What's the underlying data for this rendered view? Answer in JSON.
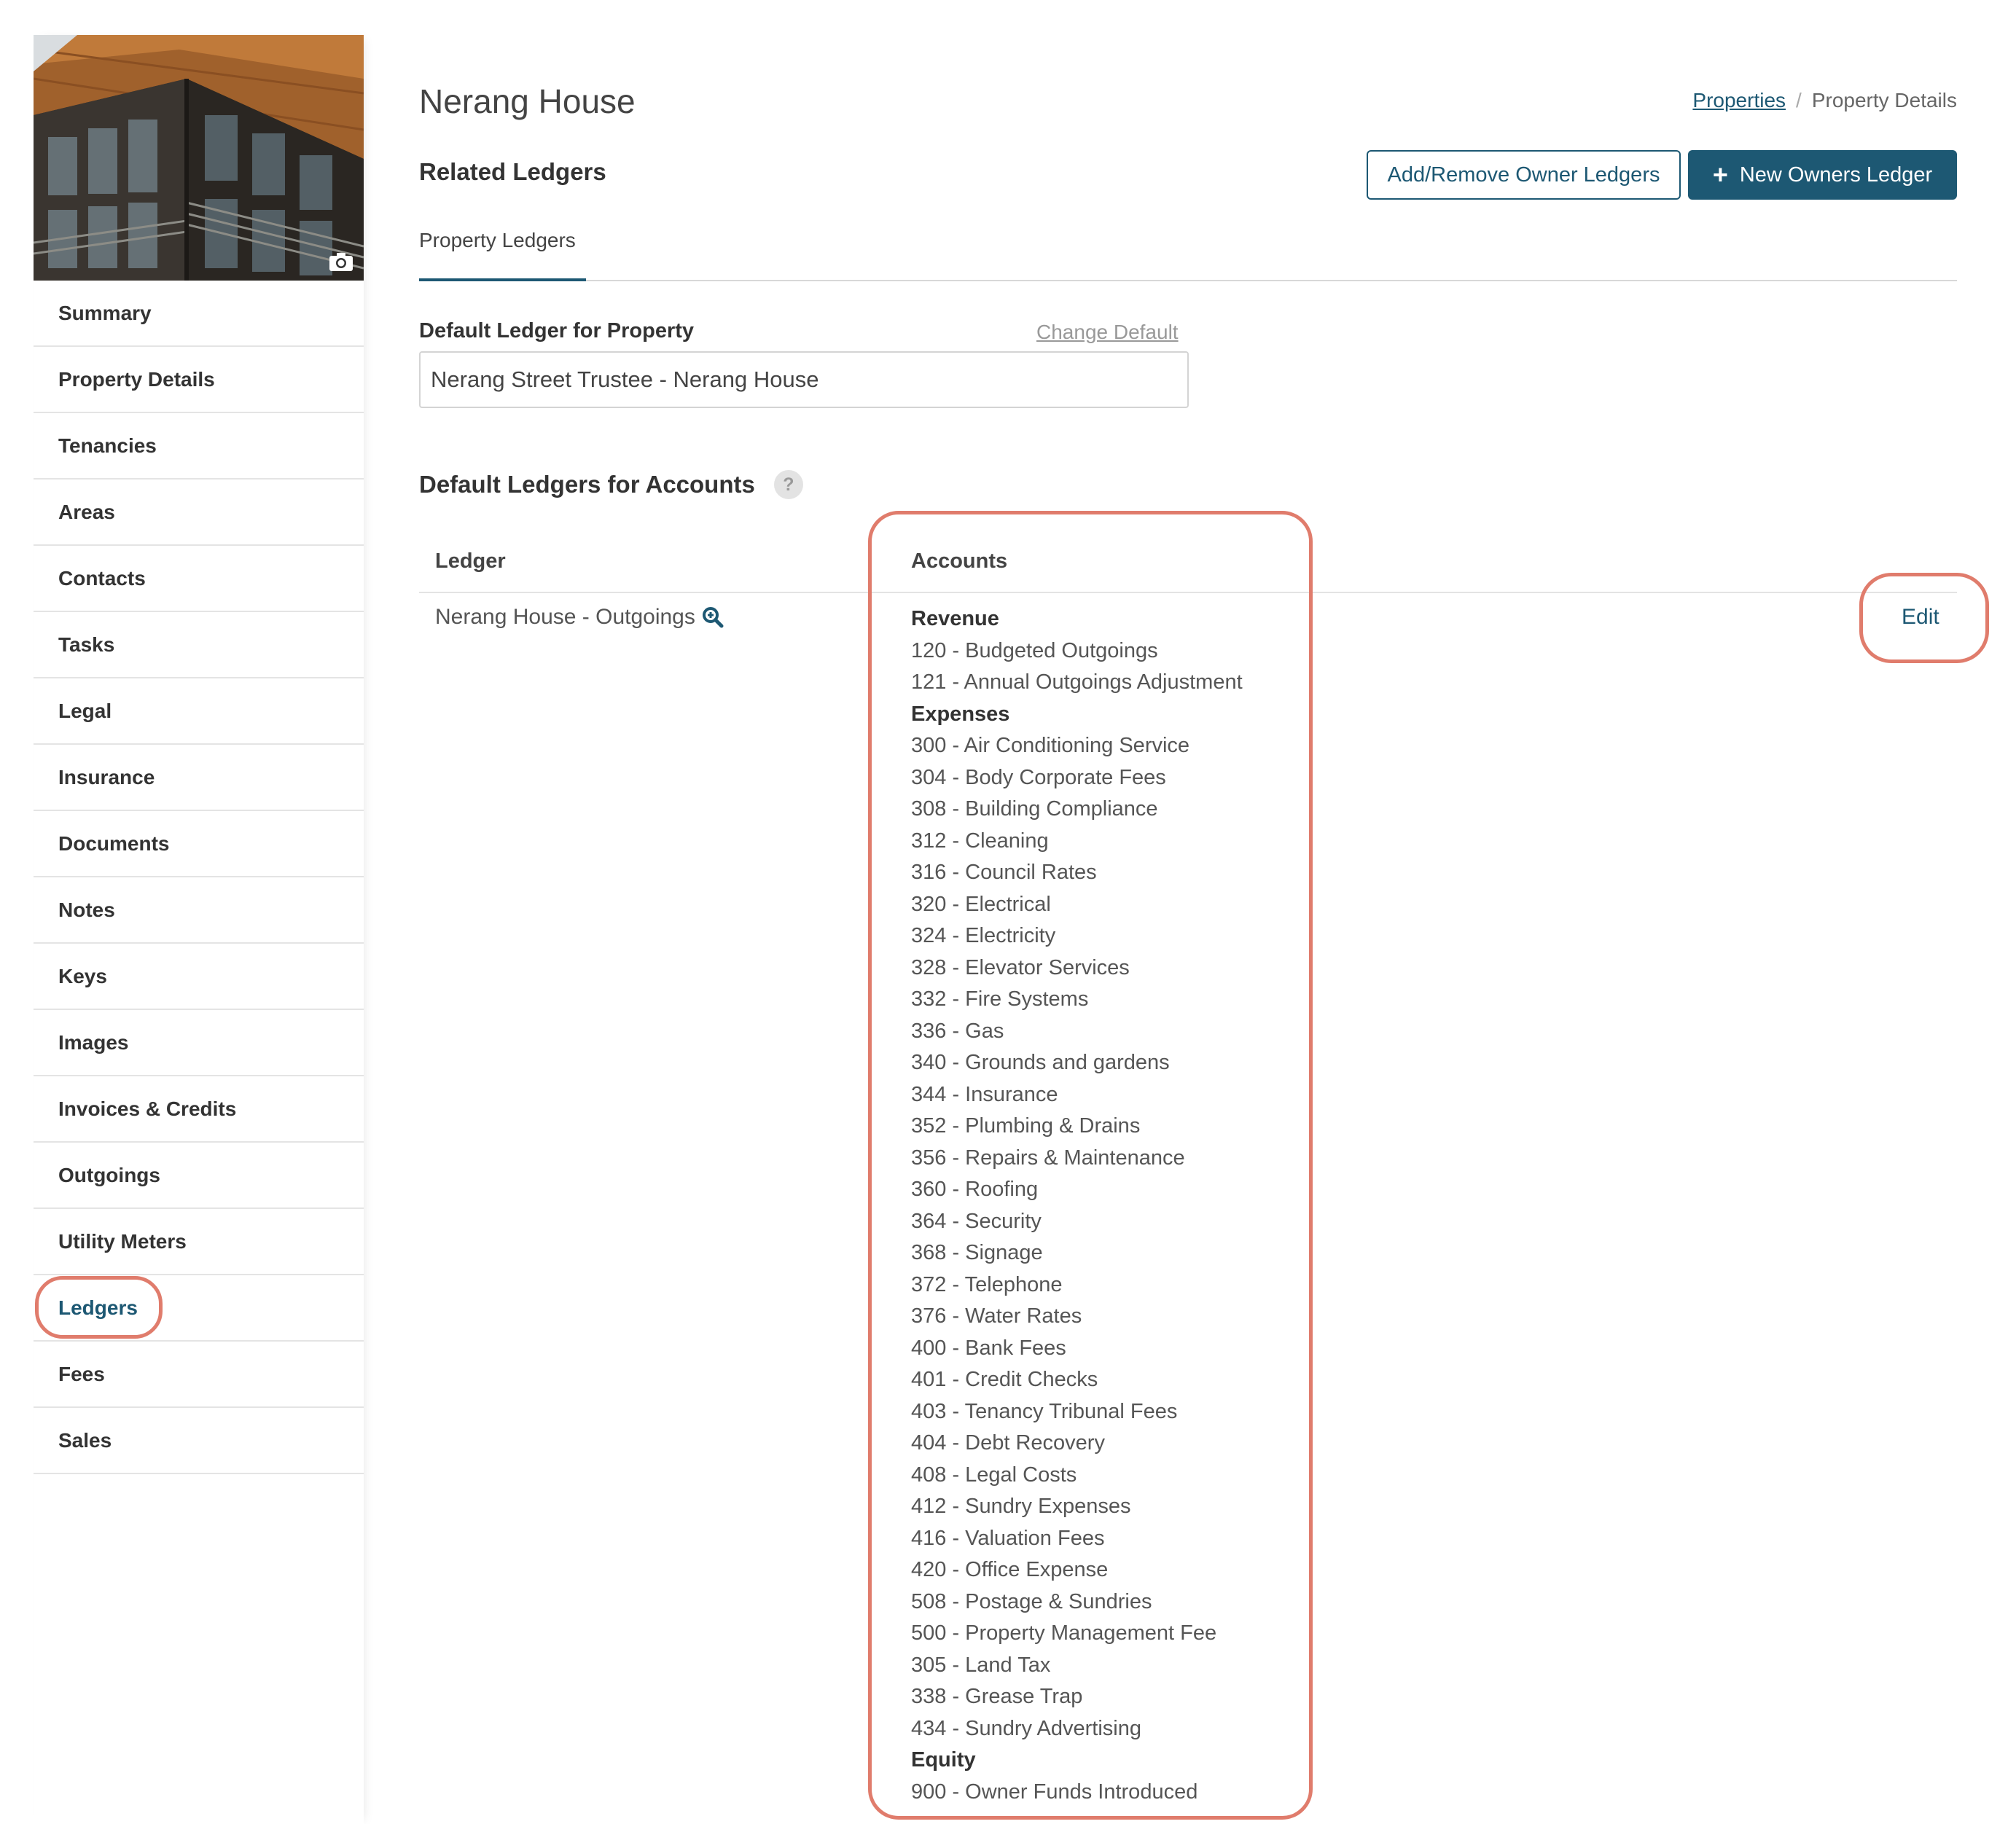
{
  "sidebar": {
    "items": [
      {
        "label": "Summary",
        "active": false
      },
      {
        "label": "Property Details",
        "active": false
      },
      {
        "label": "Tenancies",
        "active": false
      },
      {
        "label": "Areas",
        "active": false
      },
      {
        "label": "Contacts",
        "active": false
      },
      {
        "label": "Tasks",
        "active": false
      },
      {
        "label": "Legal",
        "active": false
      },
      {
        "label": "Insurance",
        "active": false
      },
      {
        "label": "Documents",
        "active": false
      },
      {
        "label": "Notes",
        "active": false
      },
      {
        "label": "Keys",
        "active": false
      },
      {
        "label": "Images",
        "active": false
      },
      {
        "label": "Invoices & Credits",
        "active": false
      },
      {
        "label": "Outgoings",
        "active": false
      },
      {
        "label": "Utility Meters",
        "active": false
      },
      {
        "label": "Ledgers",
        "active": true
      },
      {
        "label": "Fees",
        "active": false
      },
      {
        "label": "Sales",
        "active": false
      }
    ]
  },
  "header": {
    "title": "Nerang House",
    "breadcrumb": {
      "link": "Properties",
      "separator": "/",
      "current": "Property Details"
    }
  },
  "related_ledgers": {
    "title": "Related Ledgers",
    "add_remove_label": "Add/Remove Owner Ledgers",
    "new_ledger_label": "New Owners Ledger",
    "new_ledger_icon": "plus-icon"
  },
  "tabs": [
    {
      "label": "Property Ledgers",
      "active": true
    }
  ],
  "default_ledger": {
    "label": "Default Ledger for Property",
    "change_label": "Change Default",
    "value": "Nerang Street Trustee - Nerang House"
  },
  "accounts_section": {
    "title": "Default Ledgers for Accounts",
    "help_icon": "?",
    "columns": {
      "ledger": "Ledger",
      "accounts": "Accounts"
    },
    "row": {
      "ledger": "Nerang House - Outgoings",
      "ledger_icon": "zoom-icon",
      "edit_label": "Edit",
      "accounts": [
        {
          "text": "Revenue",
          "heading": true
        },
        {
          "text": "120 - Budgeted Outgoings"
        },
        {
          "text": "121 - Annual Outgoings Adjustment"
        },
        {
          "text": "Expenses",
          "heading": true
        },
        {
          "text": "300 - Air Conditioning Service"
        },
        {
          "text": "304 - Body Corporate Fees"
        },
        {
          "text": "308 - Building Compliance"
        },
        {
          "text": "312 - Cleaning"
        },
        {
          "text": "316 - Council Rates"
        },
        {
          "text": "320 - Electrical"
        },
        {
          "text": "324 - Electricity"
        },
        {
          "text": "328 - Elevator Services"
        },
        {
          "text": "332 - Fire Systems"
        },
        {
          "text": "336 - Gas"
        },
        {
          "text": "340 - Grounds and gardens"
        },
        {
          "text": "344 - Insurance"
        },
        {
          "text": "352 - Plumbing & Drains"
        },
        {
          "text": "356 - Repairs & Maintenance"
        },
        {
          "text": "360 - Roofing"
        },
        {
          "text": "364 - Security"
        },
        {
          "text": "368 - Signage"
        },
        {
          "text": "372 - Telephone"
        },
        {
          "text": "376 - Water Rates"
        },
        {
          "text": "400 - Bank Fees"
        },
        {
          "text": "401 - Credit Checks"
        },
        {
          "text": "403 - Tenancy Tribunal Fees"
        },
        {
          "text": "404 - Debt Recovery"
        },
        {
          "text": "408 - Legal Costs"
        },
        {
          "text": "412 - Sundry Expenses"
        },
        {
          "text": "416 - Valuation Fees"
        },
        {
          "text": "420 - Office Expense"
        },
        {
          "text": "508 - Postage & Sundries"
        },
        {
          "text": "500 - Property Management Fee"
        },
        {
          "text": "305 - Land Tax"
        },
        {
          "text": "338 - Grease Trap"
        },
        {
          "text": "434 - Sundry Advertising"
        },
        {
          "text": "Equity",
          "heading": true
        },
        {
          "text": "900 - Owner Funds Introduced"
        }
      ]
    }
  },
  "colors": {
    "accent": "#1d5873",
    "highlight_ring": "#e07c6c",
    "text": "#333333",
    "muted": "#999999",
    "border": "#e3e3e3"
  }
}
